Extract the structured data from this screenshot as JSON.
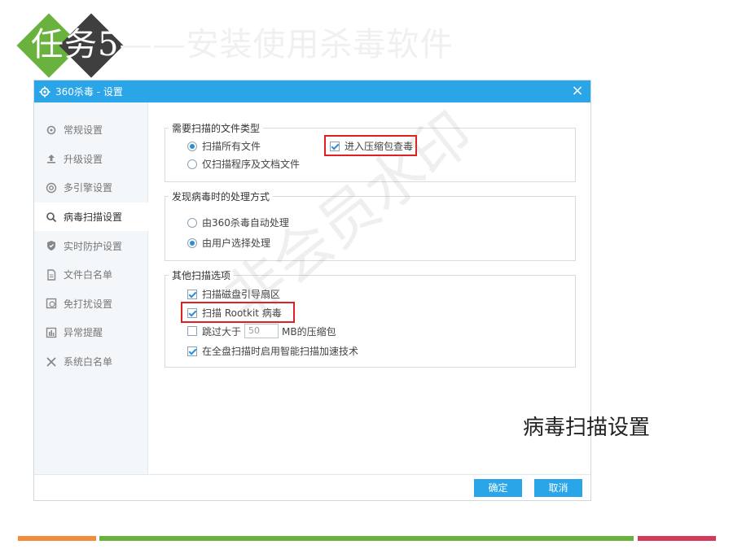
{
  "slide": {
    "title_main": "任务5",
    "title_rest": "——安装使用杀毒软件",
    "caption": "病毒扫描设置",
    "watermark": "非会员水印"
  },
  "dialog": {
    "title": "360杀毒 - 设置",
    "close_label": "×",
    "sidebar": {
      "items": [
        {
          "label": "常规设置",
          "icon": "gear-icon"
        },
        {
          "label": "升级设置",
          "icon": "upload-icon"
        },
        {
          "label": "多引擎设置",
          "icon": "engine-icon"
        },
        {
          "label": "病毒扫描设置",
          "icon": "search-icon"
        },
        {
          "label": "实时防护设置",
          "icon": "shield-icon"
        },
        {
          "label": "文件白名单",
          "icon": "file-icon"
        },
        {
          "label": "免打扰设置",
          "icon": "clock-icon"
        },
        {
          "label": "异常提醒",
          "icon": "chart-icon"
        },
        {
          "label": "系统白名单",
          "icon": "tools-icon"
        }
      ]
    },
    "groups": {
      "file_types": {
        "legend": "需要扫描的文件类型",
        "option_all": "扫描所有文件",
        "option_programs": "仅扫描程序及文档文件",
        "archive_check": "进入压缩包查毒"
      },
      "handling": {
        "legend": "发现病毒时的处理方式",
        "option_auto": "由360杀毒自动处理",
        "option_user": "由用户选择处理"
      },
      "other": {
        "legend": "其他扫描选项",
        "boot_sector": "扫描磁盘引导扇区",
        "rootkit": "扫描 Rootkit 病毒",
        "skip_prefix": "跳过大于",
        "skip_value": "50",
        "skip_suffix": "MB的压缩包",
        "smart_scan": "在全盘扫描时启用智能扫描加速技术"
      }
    },
    "state": {
      "file_types_selected": "all",
      "archive_checked": true,
      "handling_selected": "user",
      "boot_sector_checked": true,
      "rootkit_checked": true,
      "skip_checked": false,
      "smart_scan_checked": true
    },
    "footer": {
      "ok_label": "确定",
      "cancel_label": "取消"
    }
  },
  "colors": {
    "titlebar": "#2aa5e8",
    "button": "#2aa5e8",
    "highlight": "#e02020",
    "bar_orange": "#f08c3c",
    "bar_green": "#6ab23e",
    "bar_red": "#d63a5a",
    "diamond_green": "#6ab23e",
    "diamond_dark": "#3f3f3f"
  }
}
